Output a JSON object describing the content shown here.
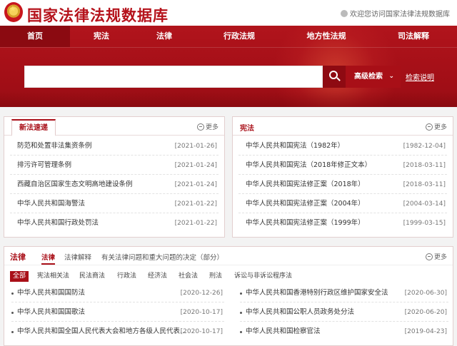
{
  "header": {
    "site_title": "国家法律法规数据库",
    "welcome": "欢迎您访问国家法律法规数据库"
  },
  "nav": {
    "items": [
      {
        "label": "首页"
      },
      {
        "label": "宪法"
      },
      {
        "label": "法律"
      },
      {
        "label": "行政法规"
      },
      {
        "label": "地方性法规"
      },
      {
        "label": "司法解释"
      }
    ]
  },
  "search": {
    "placeholder": "",
    "advanced_label": "高级检索",
    "help_link": "检索说明"
  },
  "new_laws": {
    "title": "新法速递",
    "more": "更多",
    "items": [
      {
        "title": "防范和处置非法集资条例",
        "date": "[2021-01-26]"
      },
      {
        "title": "排污许可管理条例",
        "date": "[2021-01-24]"
      },
      {
        "title": "西藏自治区国家生态文明高地建设条例",
        "date": "[2021-01-24]"
      },
      {
        "title": "中华人民共和国海警法",
        "date": "[2021-01-22]"
      },
      {
        "title": "中华人民共和国行政处罚法",
        "date": "[2021-01-22]"
      }
    ]
  },
  "constitution": {
    "title": "宪法",
    "more": "更多",
    "items": [
      {
        "title": "中华人民共和国宪法（1982年）",
        "date": "[1982-12-04]"
      },
      {
        "title": "中华人民共和国宪法（2018年修正文本）",
        "date": "[2018-03-11]"
      },
      {
        "title": "中华人民共和国宪法修正案（2018年）",
        "date": "[2018-03-11]"
      },
      {
        "title": "中华人民共和国宪法修正案（2004年）",
        "date": "[2004-03-14]"
      },
      {
        "title": "中华人民共和国宪法修正案（1999年）",
        "date": "[1999-03-15]"
      }
    ]
  },
  "laws": {
    "title": "法律",
    "more": "更多",
    "tabs": [
      {
        "label": "法律"
      },
      {
        "label": "法律解释"
      },
      {
        "label": "有关法律问题和重大问题的决定（部分）"
      }
    ],
    "filters": [
      {
        "label": "全部"
      },
      {
        "label": "宪法相关法"
      },
      {
        "label": "民法商法"
      },
      {
        "label": "行政法"
      },
      {
        "label": "经济法"
      },
      {
        "label": "社会法"
      },
      {
        "label": "刑法"
      },
      {
        "label": "诉讼与非诉讼程序法"
      }
    ],
    "left_items": [
      {
        "title": "中华人民共和国国防法",
        "date": "[2020-12-26]"
      },
      {
        "title": "中华人民共和国国歌法",
        "date": "[2020-10-17]"
      },
      {
        "title": "中华人民共和国全国人民代表大会和地方各级人民代表…",
        "date": "[2020-10-17]"
      }
    ],
    "right_items": [
      {
        "title": "中华人民共和国香港特别行政区维护国家安全法",
        "date": "[2020-06-30]"
      },
      {
        "title": "中华人民共和国公职人员政务处分法",
        "date": "[2020-06-20]"
      },
      {
        "title": "中华人民共和国检察官法",
        "date": "[2019-04-23]"
      }
    ]
  }
}
